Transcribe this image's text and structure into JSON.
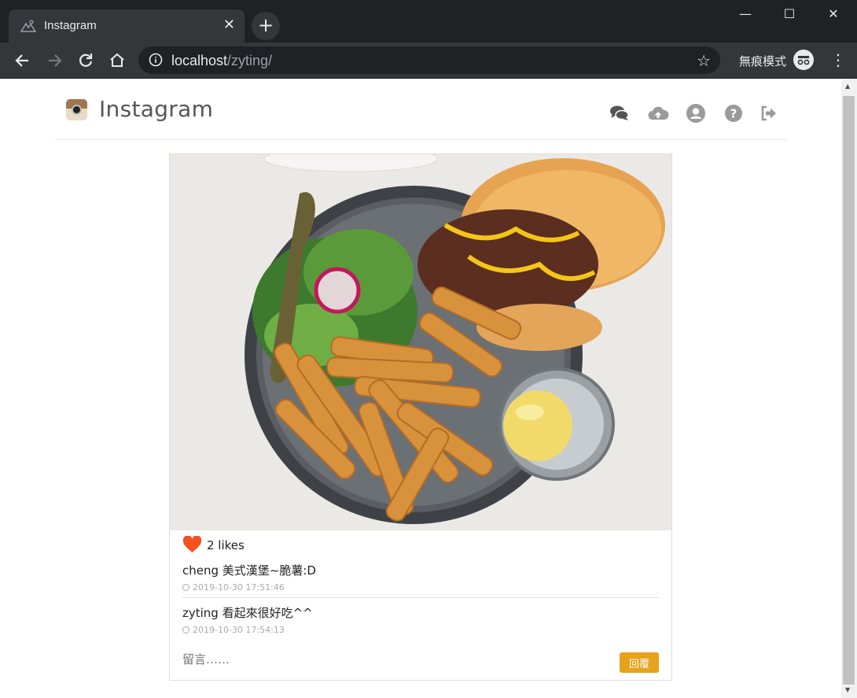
{
  "browser": {
    "tab_title": "Instagram",
    "tab_close": "✕",
    "new_tab": "+",
    "url_host": "localhost",
    "url_path": "/zyting/",
    "incognito_label": "無痕模式",
    "window_controls": {
      "minimize": "—",
      "maximize": "☐",
      "close": "✕"
    }
  },
  "site": {
    "brand": "Instagram",
    "nav_icons": [
      "comments-icon",
      "cloud-upload-icon",
      "user-circle-icon",
      "question-circle-icon",
      "sign-out-icon"
    ]
  },
  "post": {
    "image_alt": "burger-and-fries-photo",
    "likes": "2 likes",
    "comments": [
      {
        "text": "cheng 美式漢堡~脆薯:D",
        "time": "2019-10-30 17:51:46"
      },
      {
        "text": "zyting 看起來很好吃^^",
        "time": "2019-10-30 17:54:13"
      }
    ],
    "reply_placeholder": "留言……",
    "reply_button": "回覆"
  },
  "colors": {
    "heart": "#f4511e",
    "reply_button": "#e7a21b",
    "chrome_dark": "#202124",
    "chrome_tab": "#35363a"
  }
}
